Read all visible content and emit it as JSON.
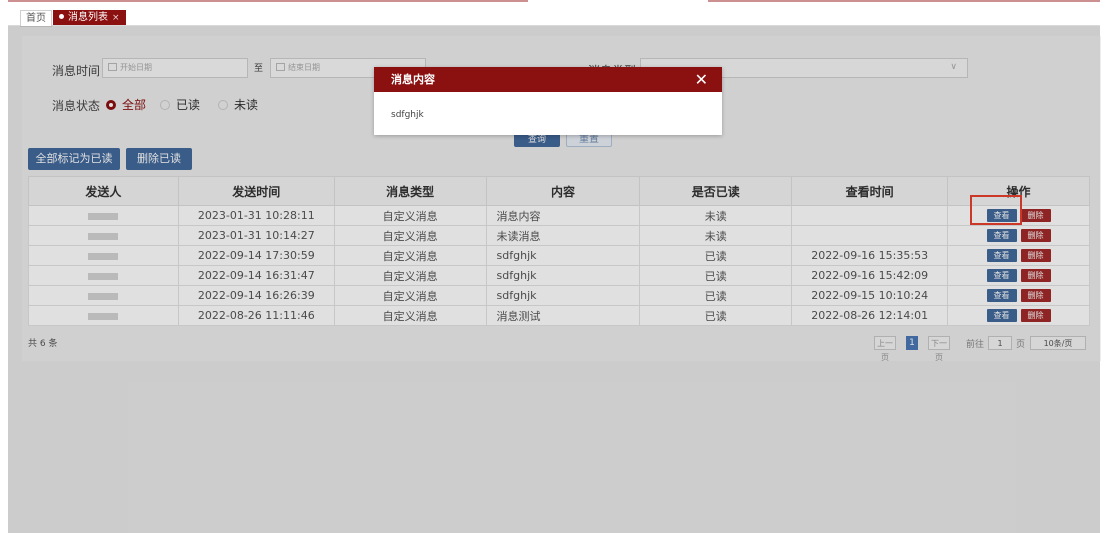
{
  "tabs": {
    "home": "首页",
    "active": "消息列表",
    "close": "×"
  },
  "filters": {
    "time_label": "消息时间",
    "start_placeholder": "开始日期",
    "to_label": "至",
    "end_placeholder": "结束日期",
    "type_label": "消息类型",
    "status_label": "消息状态",
    "status_options": [
      "全部",
      "已读",
      "未读"
    ],
    "status_selected": "全部",
    "search_button": "查询",
    "reset_button": "重置"
  },
  "toolbar": {
    "mark_all_read": "全部标记为已读",
    "delete_read": "删除已读"
  },
  "table": {
    "columns": [
      "发送人",
      "发送时间",
      "消息类型",
      "内容",
      "是否已读",
      "查看时间",
      "操作"
    ],
    "rows": [
      {
        "time": "2023-01-31 10:28:11",
        "type": "自定义消息",
        "content": "消息内容",
        "read": "未读",
        "view_time": ""
      },
      {
        "time": "2023-01-31 10:14:27",
        "type": "自定义消息",
        "content": "未读消息",
        "read": "未读",
        "view_time": ""
      },
      {
        "time": "2022-09-14 17:30:59",
        "type": "自定义消息",
        "content": "sdfghjk",
        "read": "已读",
        "view_time": "2022-09-16 15:35:53"
      },
      {
        "time": "2022-09-14 16:31:47",
        "type": "自定义消息",
        "content": "sdfghjk",
        "read": "已读",
        "view_time": "2022-09-16 15:42:09"
      },
      {
        "time": "2022-09-14 16:26:39",
        "type": "自定义消息",
        "content": "sdfghjk",
        "read": "已读",
        "view_time": "2022-09-15 10:10:24"
      },
      {
        "time": "2022-08-26 11:11:46",
        "type": "自定义消息",
        "content": "消息测试",
        "read": "已读",
        "view_time": "2022-08-26 12:14:01"
      }
    ],
    "view_label": "查看",
    "delete_label": "删除"
  },
  "pagination": {
    "total": "共 6 条",
    "prev": "上一页",
    "current": "1",
    "next": "下一页",
    "goto_label": "前往",
    "goto_value": "1",
    "page_unit": "页",
    "page_size": "10条/页"
  },
  "dialog": {
    "title": "消息内容",
    "close": "✕",
    "body": "sdfghjk"
  },
  "colors": {
    "brand_red": "#8b1010",
    "primary_blue": "#42699c",
    "delete_red": "#a32a2a",
    "highlight": "#e8402e"
  }
}
